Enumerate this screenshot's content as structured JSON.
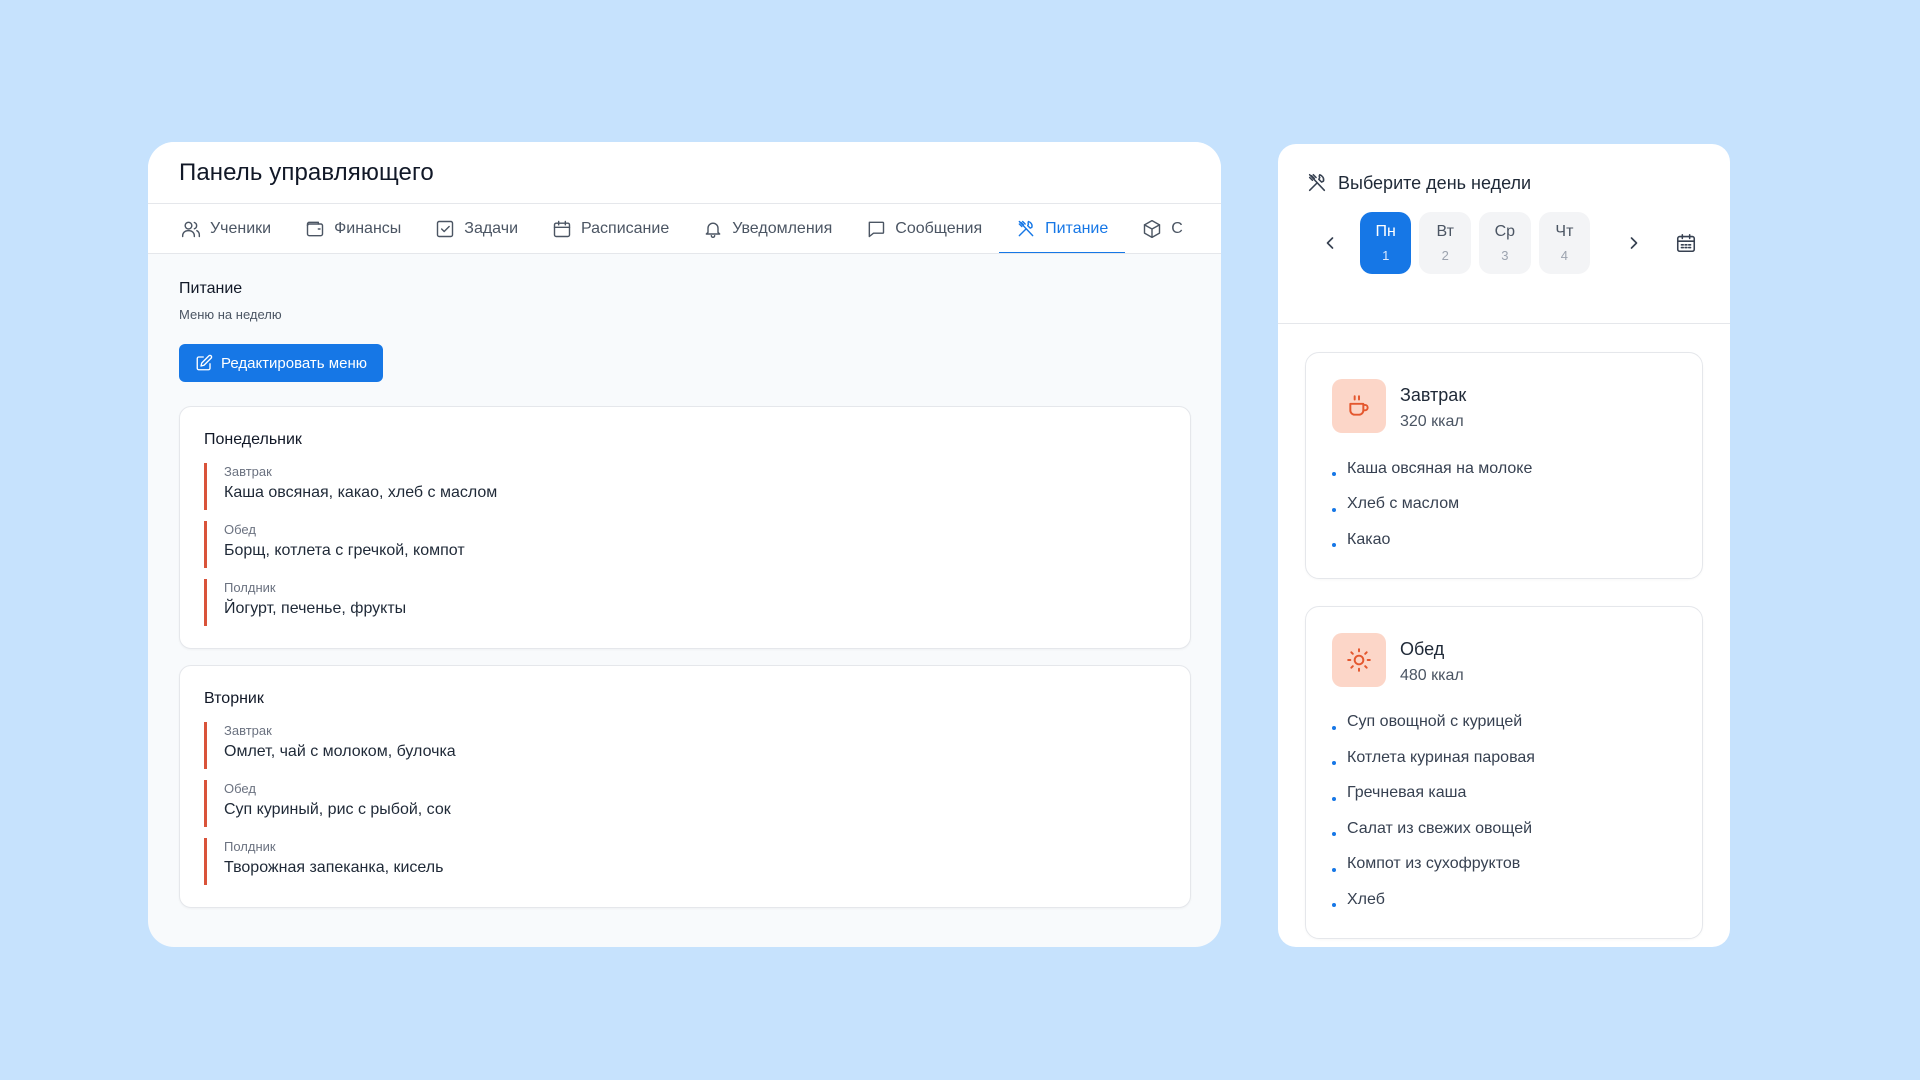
{
  "panel": {
    "title": "Панель управляющего",
    "tabs": [
      {
        "label": "Ученики",
        "icon": "users-icon"
      },
      {
        "label": "Финансы",
        "icon": "wallet-icon"
      },
      {
        "label": "Задачи",
        "icon": "checkbox-icon"
      },
      {
        "label": "Расписание",
        "icon": "calendar-icon"
      },
      {
        "label": "Уведомления",
        "icon": "bell-icon"
      },
      {
        "label": "Сообщения",
        "icon": "message-icon"
      },
      {
        "label": "Питание",
        "icon": "utensils-icon",
        "active": true
      },
      {
        "label": "С",
        "icon": "box-icon"
      }
    ],
    "section_title": "Питание",
    "section_subtitle": "Меню на неделю",
    "edit_button": "Редактировать меню",
    "days": [
      {
        "name": "Понедельник",
        "meals": [
          {
            "label": "Завтрак",
            "text": "Каша овсяная, какао, хлеб с маслом"
          },
          {
            "label": "Обед",
            "text": "Борщ, котлета с гречкой, компот"
          },
          {
            "label": "Полдник",
            "text": "Йогурт, печенье, фрукты"
          }
        ]
      },
      {
        "name": "Вторник",
        "meals": [
          {
            "label": "Завтрак",
            "text": "Омлет, чай с молоком, булочка"
          },
          {
            "label": "Обед",
            "text": "Суп куриный, рис с рыбой, сок"
          },
          {
            "label": "Полдник",
            "text": "Творожная запеканка, кисель"
          }
        ]
      }
    ]
  },
  "day_picker": {
    "heading": "Выберите день недели",
    "days": [
      {
        "name": "Пн",
        "num": "1",
        "active": true
      },
      {
        "name": "Вт",
        "num": "2"
      },
      {
        "name": "Ср",
        "num": "3"
      },
      {
        "name": "Чт",
        "num": "4"
      }
    ]
  },
  "meal_cards": [
    {
      "title": "Завтрак",
      "kcal": "320 ккал",
      "icon": "coffee-icon",
      "items": [
        "Каша овсяная на молоке",
        "Хлеб с маслом",
        "Какао"
      ]
    },
    {
      "title": "Обед",
      "kcal": "480 ккал",
      "icon": "sun-icon",
      "items": [
        "Суп овощной с курицей",
        "Котлета куриная паровая",
        "Гречневая каша",
        "Салат из свежих овощей",
        "Компот из сухофруктов",
        "Хлеб"
      ]
    }
  ],
  "colors": {
    "background": "#c6e2fd",
    "accent": "#1677e6",
    "meal_border": "#d9533a",
    "meal_icon_bg": "#fcd6c8",
    "meal_icon_stroke": "#e4572e"
  }
}
